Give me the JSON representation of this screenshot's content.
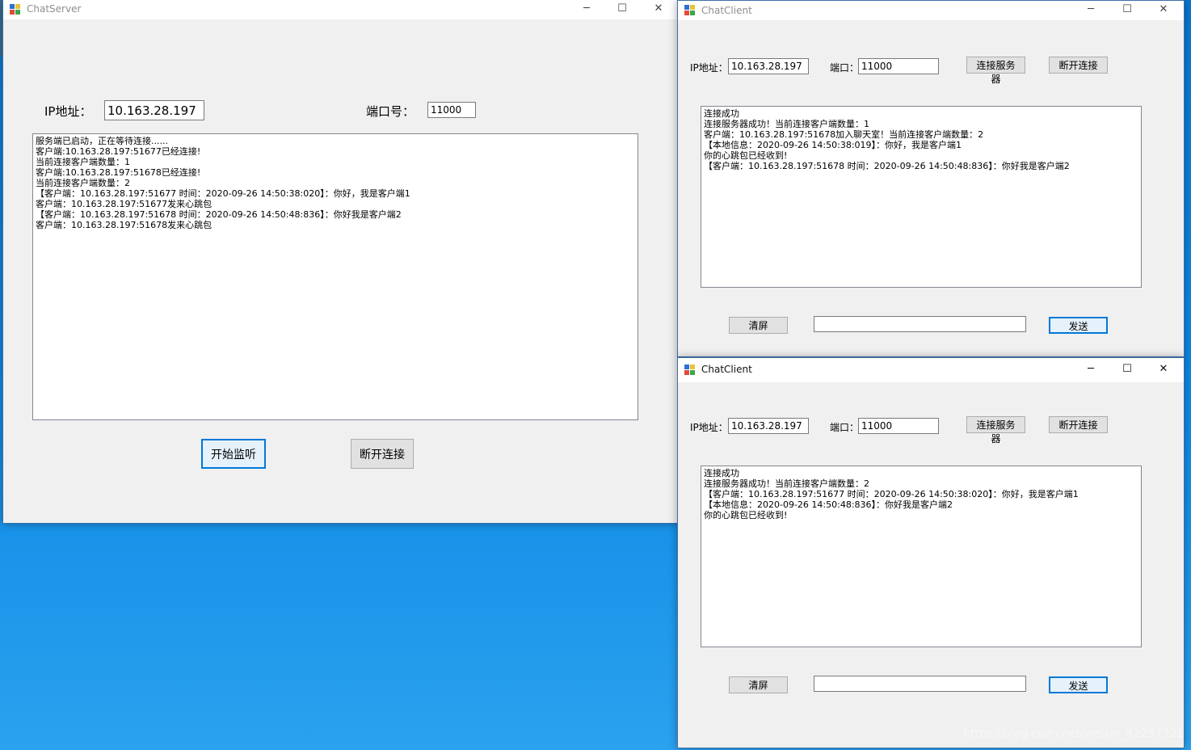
{
  "server": {
    "title": "ChatServer",
    "ip_label": "IP地址：",
    "ip_value": "10.163.28.197",
    "port_label": "端口号：",
    "port_value": "11000",
    "log": [
      "服务端已启动，正在等待连接......",
      "客户端:10.163.28.197:51677已经连接!",
      "当前连接客户端数量：1",
      "客户端:10.163.28.197:51678已经连接!",
      "当前连接客户端数量：2",
      "【客户端：10.163.28.197:51677 时间：2020-09-26 14:50:38:020】：你好，我是客户端1",
      "客户端：10.163.28.197:51677发来心跳包",
      "【客户端：10.163.28.197:51678 时间：2020-09-26 14:50:48:836】：你好我是客户端2",
      "客户端：10.163.28.197:51678发来心跳包"
    ],
    "start_button": "开始监听",
    "disconnect_button": "断开连接"
  },
  "client1": {
    "title": "ChatClient",
    "ip_label": "IP地址：",
    "ip_value": "10.163.28.197",
    "port_label": "端口：",
    "port_value": "11000",
    "connect_button": "连接服务器",
    "disconnect_button": "断开连接",
    "log": [
      "连接成功",
      "连接服务器成功！当前连接客户端数量：1",
      "客户端：10.163.28.197:51678加入聊天室！当前连接客户端数量：2",
      "【本地信息：2020-09-26 14:50:38:019】：你好，我是客户端1",
      "你的心跳包已经收到!",
      "【客户端：10.163.28.197:51678 时间：2020-09-26 14:50:48:836】：你好我是客户端2"
    ],
    "clear_button": "清屏",
    "message_value": "",
    "send_button": "发送"
  },
  "client2": {
    "title": "ChatClient",
    "ip_label": "IP地址：",
    "ip_value": "10.163.28.197",
    "port_label": "端口：",
    "port_value": "11000",
    "connect_button": "连接服务器",
    "disconnect_button": "断开连接",
    "log": [
      "连接成功",
      "连接服务器成功！当前连接客户端数量：2",
      "【客户端：10.163.28.197:51677 时间：2020-09-26 14:50:38:020】：你好，我是客户端1",
      "【本地信息：2020-09-26 14:50:48:836】：你好我是客户端2",
      "你的心跳包已经收到!"
    ],
    "clear_button": "清屏",
    "message_value": "",
    "send_button": "发送"
  },
  "titlebar_buttons": {
    "minimize": "─",
    "maximize": "☐",
    "close": "✕"
  },
  "watermark": "https://blog.csdn.net/weixin_42297321",
  "icons": [
    "app-icon",
    "minimize-icon",
    "maximize-icon",
    "close-icon"
  ]
}
